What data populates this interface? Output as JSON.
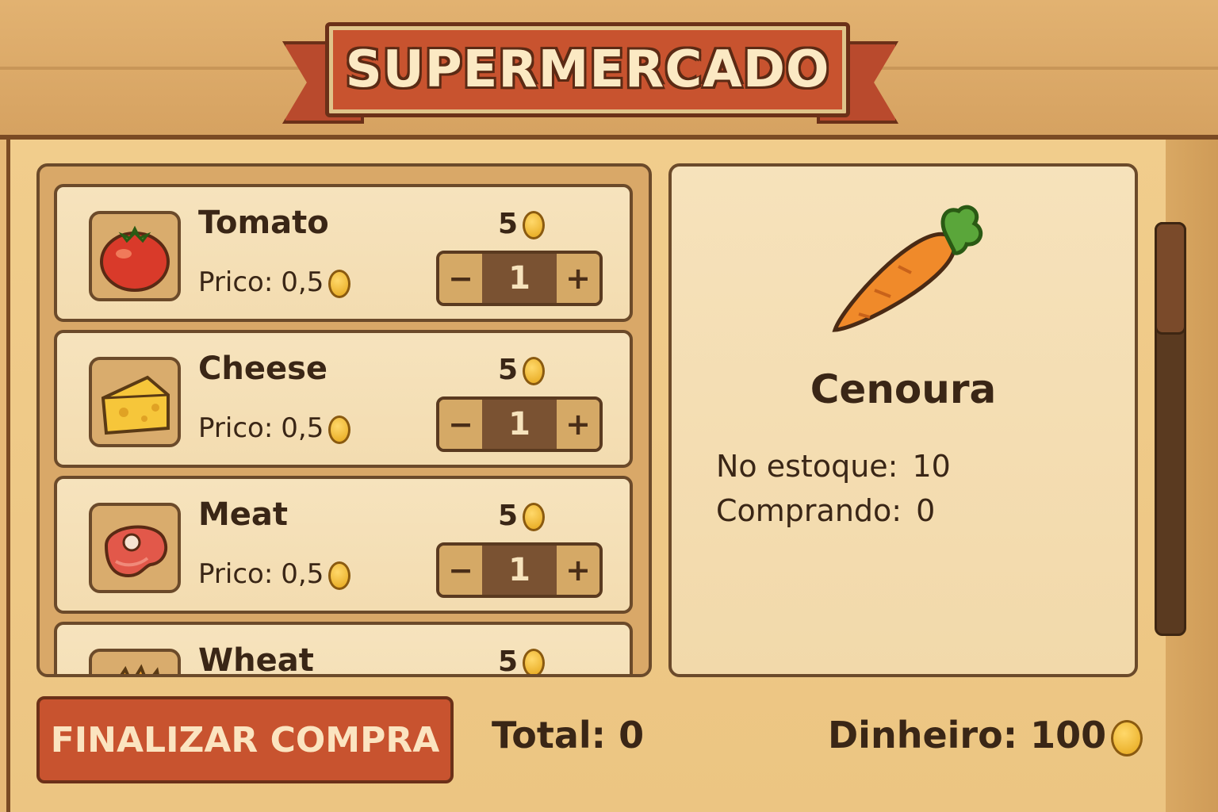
{
  "title": "SUPERMERCADO",
  "items": [
    {
      "name": "Tomato",
      "stock": "5",
      "price_label": "Prico:",
      "price": "0,5",
      "qty": "1",
      "icon": "tomato-icon"
    },
    {
      "name": "Cheese",
      "stock": "5",
      "price_label": "Prico:",
      "price": "0,5",
      "qty": "1",
      "icon": "cheese-icon"
    },
    {
      "name": "Meat",
      "stock": "5",
      "price_label": "Prico:",
      "price": "0,5",
      "qty": "1",
      "icon": "meat-icon"
    },
    {
      "name": "Wheat",
      "stock": "5",
      "icon": "wheat-icon"
    }
  ],
  "stepper": {
    "minus": "−",
    "plus": "+"
  },
  "detail": {
    "name": "Cenoura",
    "icon": "carrot-icon",
    "stock_label": "No estoque:",
    "stock_value": "10",
    "buying_label": "Comprando:",
    "buying_value": "0"
  },
  "footer": {
    "finish_label": "FINALIZAR COMPRA",
    "total_label": "Total:",
    "total_value": "0",
    "money_label": "Dinheiro:",
    "money_value": "100"
  },
  "colors": {
    "accent": "#c8532f",
    "panel": "#f6e3bd",
    "outline": "#6b4a2a",
    "coin": "#f0b52a"
  }
}
